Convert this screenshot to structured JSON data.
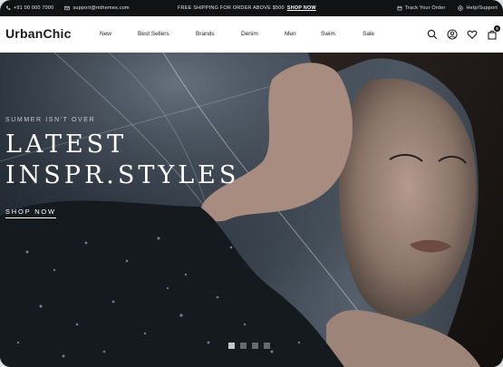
{
  "topbar": {
    "phone": "+91 00 000 7000",
    "email": "support@mthemes.com",
    "promo": "FREE SHIPPING FOR ORDER ABOVE $500",
    "promo_link": "SHOP NOW",
    "track_order": "Track Your Order",
    "help": "Help/Support"
  },
  "header": {
    "logo": "UrbanChic",
    "nav": [
      "New",
      "Best Sellers",
      "Brands",
      "Denim",
      "Men",
      "Swim",
      "Sale"
    ],
    "cart_count": "0"
  },
  "hero": {
    "eyebrow": "SUMMER ISN'T OVER",
    "title_line1": "LATEST",
    "title_line2": "INSPR.STYLES",
    "cta": "SHOP NOW",
    "slides": 4,
    "active_slide": 1
  },
  "colors": {
    "topbar_bg": "#111214",
    "hero_bg": "#27313c",
    "text_dark": "#1a1a1a"
  }
}
